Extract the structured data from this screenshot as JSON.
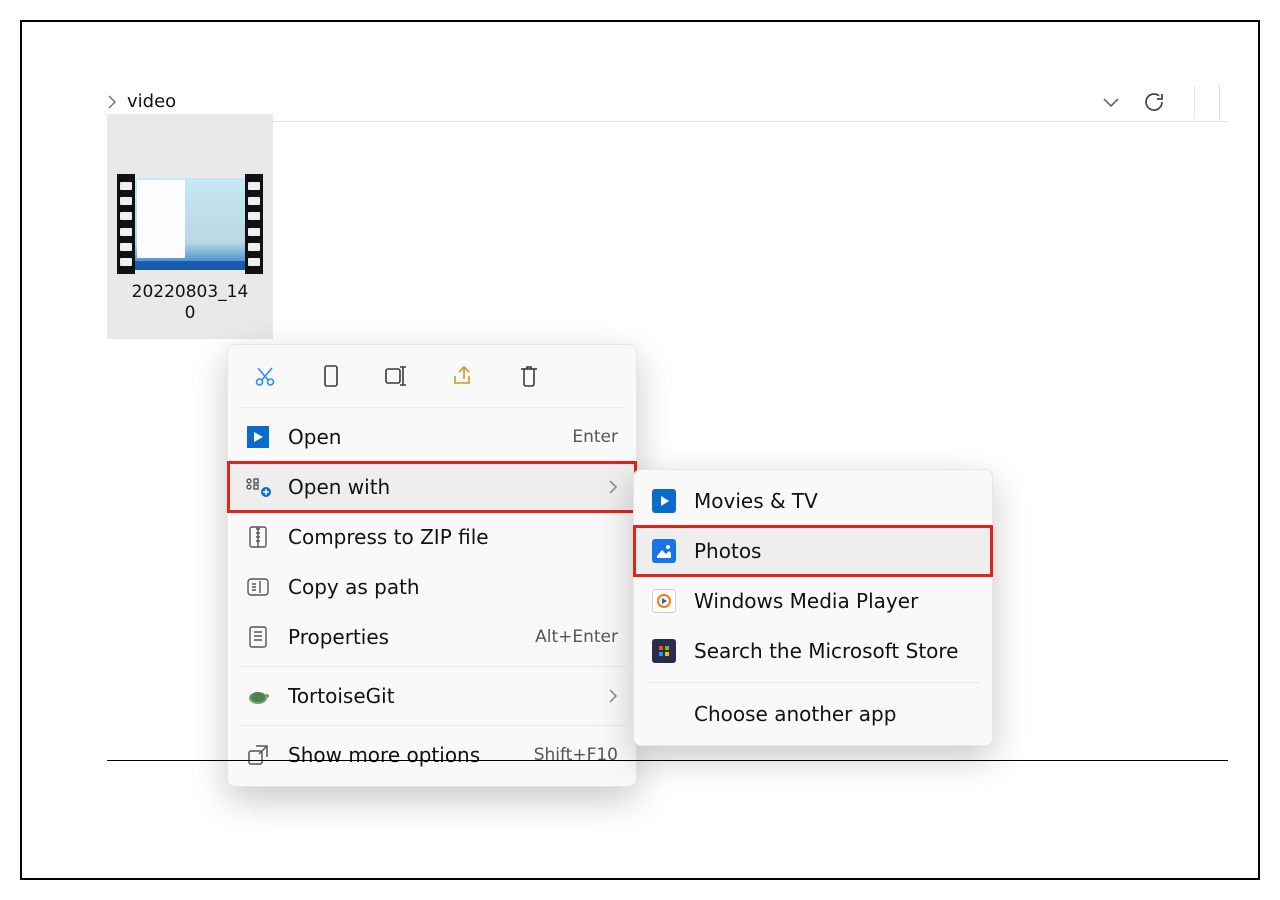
{
  "breadcrumb": {
    "folder": "video"
  },
  "file": {
    "name_line1": "20220803_14",
    "name_line2": "0"
  },
  "menu": {
    "open": {
      "label": "Open",
      "accel": "Enter"
    },
    "open_with": {
      "label": "Open with"
    },
    "compress": {
      "label": "Compress to ZIP file"
    },
    "copy_path": {
      "label": "Copy as path"
    },
    "properties": {
      "label": "Properties",
      "accel": "Alt+Enter"
    },
    "tortoisegit": {
      "label": "TortoiseGit"
    },
    "show_more": {
      "label": "Show more options",
      "accel": "Shift+F10"
    }
  },
  "submenu": {
    "movies_tv": {
      "label": "Movies & TV"
    },
    "photos": {
      "label": "Photos"
    },
    "wmp": {
      "label": "Windows Media Player"
    },
    "store": {
      "label": "Search the Microsoft Store"
    },
    "choose": {
      "label": "Choose another app"
    }
  }
}
